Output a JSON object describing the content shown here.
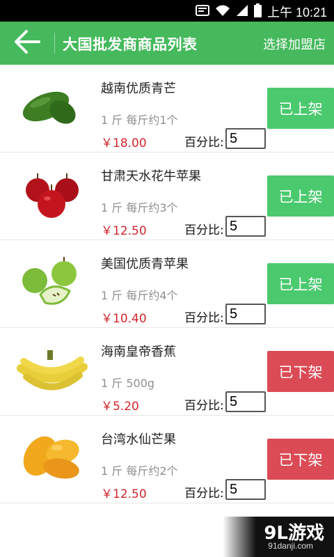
{
  "status_bar": {
    "time": "上午 10:21",
    "icons": [
      "notification-icon",
      "wifi-icon",
      "signal-icon",
      "battery-icon"
    ]
  },
  "header": {
    "title": "大国批发商商品列表",
    "action_label": "选择加盟店",
    "back_icon": "arrow-left-icon",
    "background_color": "#45b95c"
  },
  "products": [
    {
      "name": "越南优质青芒",
      "unit": "1 斤 每斤约1个",
      "price": "￥18.00",
      "percent_label": "百分比:",
      "percent_value": "5",
      "status": "已上架",
      "state": "on",
      "image": "green-mango"
    },
    {
      "name": "甘肃天水花牛苹果",
      "unit": "1 斤 每斤约3个",
      "price": "￥12.50",
      "percent_label": "百分比:",
      "percent_value": "5",
      "status": "已上架",
      "state": "on",
      "image": "red-apples"
    },
    {
      "name": "美国优质青苹果",
      "unit": "1 斤 每斤约4个",
      "price": "￥10.40",
      "percent_label": "百分比:",
      "percent_value": "5",
      "status": "已上架",
      "state": "on",
      "image": "green-apples"
    },
    {
      "name": "海南皇帝香蕉",
      "unit": "1 斤 500g",
      "price": "￥5.20",
      "percent_label": "百分比:",
      "percent_value": "5",
      "status": "已下架",
      "state": "off",
      "image": "bananas"
    },
    {
      "name": "台湾水仙芒果",
      "unit": "1 斤 每斤约2个",
      "price": "￥12.50",
      "percent_label": "百分比:",
      "percent_value": "5",
      "status": "已下架",
      "state": "off",
      "image": "yellow-mangoes"
    }
  ],
  "colors": {
    "on": "#4bc96f",
    "off": "#db4b55",
    "price": "#d0262c"
  },
  "watermark": {
    "logo": "9L游戏",
    "site": "91danji.com"
  }
}
